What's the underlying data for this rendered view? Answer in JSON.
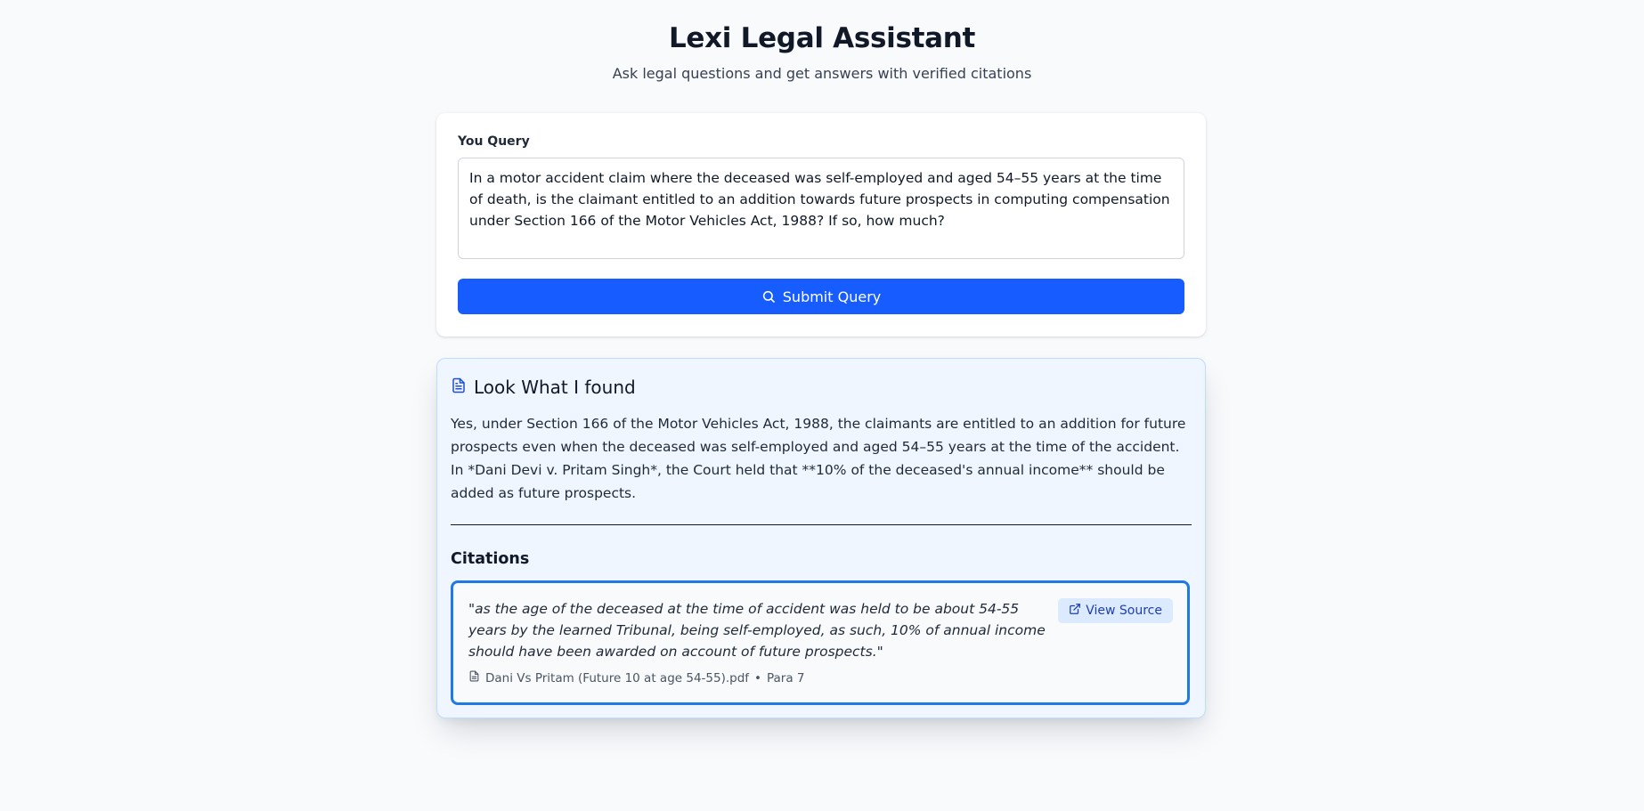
{
  "header": {
    "title": "Lexi Legal Assistant",
    "subtitle": "Ask legal questions and get answers with verified citations"
  },
  "query": {
    "label": "You Query",
    "value": "In a motor accident claim where the deceased was self-employed and aged 54–55 years at the time of death, is the claimant entitled to an addition towards future prospects in computing compensation under Section 166 of the Motor Vehicles Act, 1988? If so, how much?",
    "submit_label": "Submit Query",
    "submit_icon": "search-icon"
  },
  "result": {
    "title": "Look What I found",
    "title_icon": "document-icon",
    "answer": "Yes, under Section 166 of the Motor Vehicles Act, 1988, the claimants are entitled to an addition for future prospects even when the deceased was self-employed and aged 54–55 years at the time of the accident. In *Dani Devi v. Pritam Singh*, the Court held that **10% of the deceased's annual income** should be added as future prospects.",
    "citations_heading": "Citations",
    "citations": [
      {
        "quote": "\"as the age of the deceased at the time of accident was held to be about 54-55 years by the learned Tribunal, being self-employed, as such, 10% of annual income should have been awarded on account of future prospects.\"",
        "source_file": "Dani Vs Pritam (Future 10 at age 54-55).pdf",
        "separator": "•",
        "paragraph": "Para 7",
        "view_source_label": "View Source",
        "view_source_icon": "external-link-icon",
        "file_icon": "file-icon"
      }
    ]
  },
  "colors": {
    "page_background": "#f8fafc",
    "primary_button": "#175cff",
    "result_background": "#eff6ff",
    "citation_border": "#1f7ae6",
    "view_source_background": "#dbeafe"
  }
}
